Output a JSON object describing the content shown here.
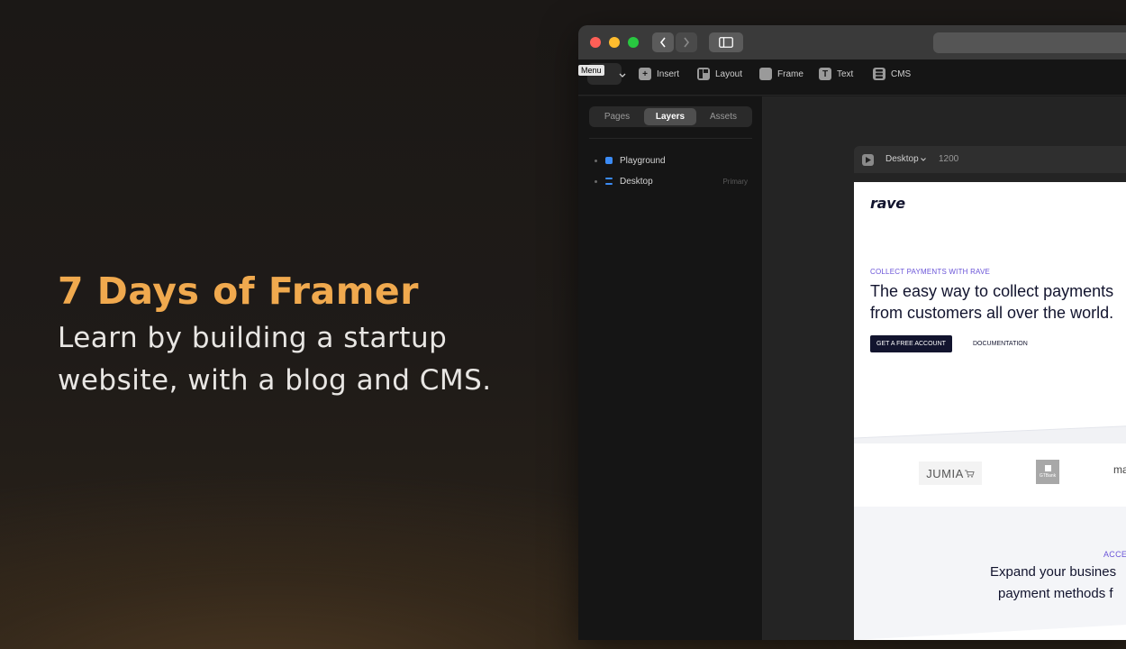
{
  "promo": {
    "title": "7 Days of Framer",
    "subtitle_line1": "Learn by building a startup",
    "subtitle_line2": "website, with a blog and CMS."
  },
  "toolbar": {
    "menu_label": "Menu",
    "insert_label": "Insert",
    "layout_label": "Layout",
    "frame_label": "Frame",
    "text_label": "Text",
    "cms_label": "CMS"
  },
  "panel": {
    "tabs": [
      "Pages",
      "Layers",
      "Assets"
    ],
    "active_tab": "Layers",
    "layers": [
      {
        "label": "Playground",
        "tag": ""
      },
      {
        "label": "Desktop",
        "tag": "Primary"
      }
    ]
  },
  "frame": {
    "breakpoint": "Desktop",
    "width": "1200"
  },
  "site": {
    "logo": "rave",
    "hero_eyebrow": "COLLECT PAYMENTS WITH RAVE",
    "hero_line1": "The easy way to collect payments",
    "hero_line2": "from customers all over the world.",
    "cta_primary": "GET A FREE ACCOUNT",
    "cta_secondary": "DOCUMENTATION",
    "logos": {
      "jumia": "JUMIA",
      "gtbank": "GTBank",
      "ma": "ma"
    },
    "section2_eyebrow": "ACCE",
    "section2_line1": "Expand your busines",
    "section2_line2": "payment methods f"
  },
  "colors": {
    "accent_orange": "#f0a94e",
    "brand_navy": "#12142e",
    "brand_purple": "#6a54d8",
    "layer_blue": "#3b8bf5"
  }
}
